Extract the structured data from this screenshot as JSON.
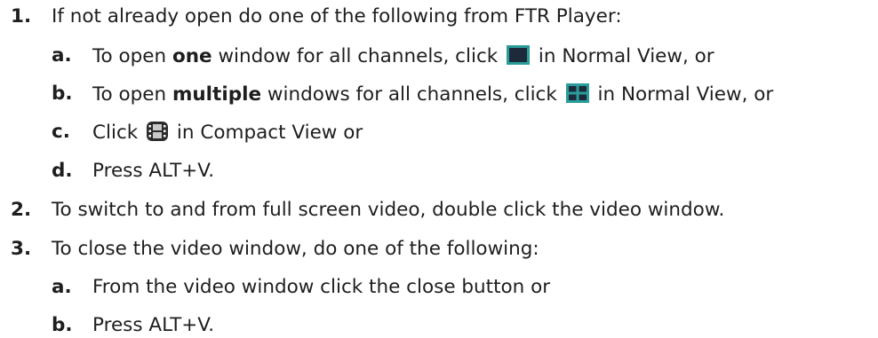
{
  "steps": [
    {
      "num": "1.",
      "text": "If not already open do one of the following from FTR Player:",
      "sub": [
        {
          "letter": "a.",
          "pre": "To open ",
          "bold": "one",
          "mid": " window for all channels, click ",
          "icon": "single-window-icon",
          "post": " in Normal View, or"
        },
        {
          "letter": "b.",
          "pre": "To open ",
          "bold": "multiple",
          "mid": " windows for all channels, click ",
          "icon": "multi-window-icon",
          "post": " in Normal View, or"
        },
        {
          "letter": "c.",
          "pre": "Click ",
          "icon": "film-video-icon",
          "post": " in Compact View or"
        },
        {
          "letter": "d.",
          "text": "Press ALT+V."
        }
      ]
    },
    {
      "num": "2.",
      "text": "To switch to and from full screen video, double click the video window."
    },
    {
      "num": "3.",
      "text": "To close the video window, do one of the following:",
      "sub": [
        {
          "letter": "a.",
          "text": "From the video window click the close button or"
        },
        {
          "letter": "b.",
          "text": "Press ALT+V."
        }
      ]
    }
  ],
  "colors": {
    "icon_teal": "#2a9d9a",
    "icon_dark": "#1d2a3a",
    "icon_film": "#2b2b2b"
  }
}
